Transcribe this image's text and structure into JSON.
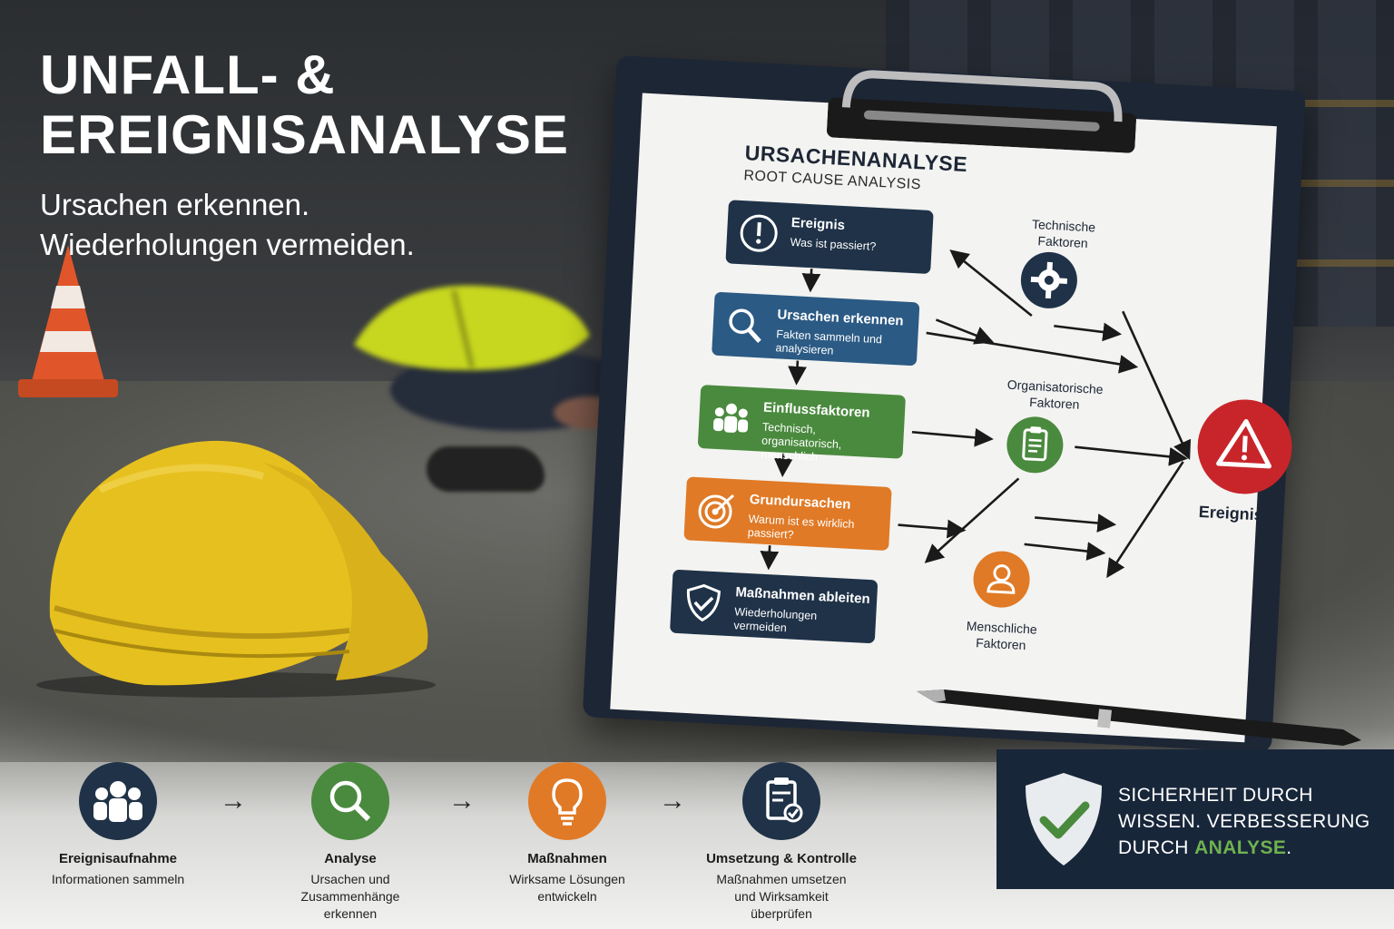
{
  "header": {
    "title_line1": "UNFALL- &",
    "title_line2": "EREIGNISANALYSE",
    "subtitle_line1": "Ursachen erkennen.",
    "subtitle_line2": "Wiederholungen vermeiden."
  },
  "sheet": {
    "title": "URSACHENANALYSE",
    "subtitle": "ROOT CAUSE ANALYSIS",
    "steps": [
      {
        "title": "Ereignis",
        "desc": "Was ist passiert?",
        "icon": "alert-icon",
        "color": "#1f3248"
      },
      {
        "title": "Ursachen erkennen",
        "desc": "Fakten sammeln und analysieren",
        "icon": "search-icon",
        "color": "#2b5a84"
      },
      {
        "title": "Einflussfaktoren",
        "desc": "Technisch, organisatorisch, menschlich",
        "icon": "people-icon",
        "color": "#4a8a3e"
      },
      {
        "title": "Grundursachen",
        "desc": "Warum ist es wirklich passiert?",
        "icon": "target-icon",
        "color": "#e07a26"
      },
      {
        "title": "Maßnahmen ableiten",
        "desc": "Wiederholungen vermeiden",
        "icon": "shield-check-icon",
        "color": "#1f3248"
      }
    ],
    "factors": {
      "technical_line1": "Technische",
      "technical_line2": "Faktoren",
      "organizational_line1": "Organisatorische",
      "organizational_line2": "Faktoren",
      "human_line1": "Menschliche",
      "human_line2": "Faktoren"
    },
    "event_label": "Ereignis"
  },
  "process": [
    {
      "label": "Ereignisaufnahme",
      "desc_line1": "Informationen sammeln",
      "desc_line2": "",
      "desc_line3": "",
      "icon": "people-icon",
      "color": "#1f3248"
    },
    {
      "label": "Analyse",
      "desc_line1": "Ursachen und",
      "desc_line2": "Zusammenhänge",
      "desc_line3": "erkennen",
      "icon": "search-icon",
      "color": "#4a8a3e"
    },
    {
      "label": "Maßnahmen",
      "desc_line1": "Wirksame Lösungen",
      "desc_line2": "entwickeln",
      "desc_line3": "",
      "icon": "lightbulb-icon",
      "color": "#e07a26"
    },
    {
      "label": "Umsetzung & Kontrolle",
      "desc_line1": "Maßnahmen umsetzen",
      "desc_line2": "und Wirksamkeit",
      "desc_line3": "überprüfen",
      "icon": "clipboard-check-icon",
      "color": "#1f3248"
    }
  ],
  "arrows": {
    "symbol": "→"
  },
  "safety": {
    "line1": "SICHERHEIT DURCH",
    "line2": "WISSEN. VERBESSERUNG",
    "line3_prefix": "DURCH ",
    "line3_highlight": "ANALYSE",
    "line3_suffix": ".",
    "accent": "#6fb24f",
    "icon": "shield-check-icon"
  }
}
